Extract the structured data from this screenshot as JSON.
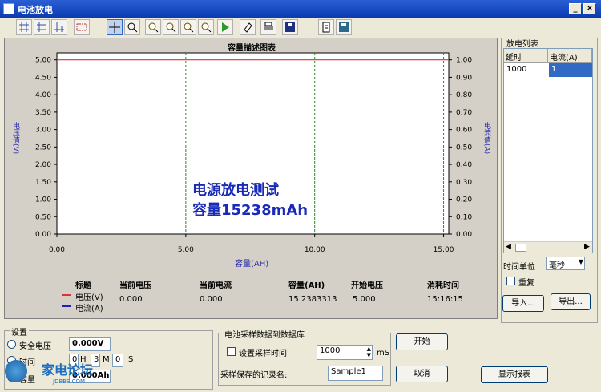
{
  "window": {
    "title": "电池放电",
    "min": "_",
    "close": "×"
  },
  "toolbar": {
    "icons": [
      "cursor-a-icon",
      "cursor-b-icon",
      "cursor-c-icon",
      "select-rect-icon",
      "pan-icon",
      "zoom-auto-icon",
      "zoom-in-icon",
      "zoom-out-icon",
      "zoom-icon",
      "zoom-fit-icon",
      "play-icon",
      "eraser-icon",
      "print-icon",
      "save-icon",
      "page-icon",
      "disk-icon"
    ]
  },
  "chart": {
    "title": "容量描述图表",
    "ylabel": "电压值(V)",
    "y2label": "电流值(A)",
    "xlabel": "容量(AH)",
    "overlay1": "电源放电测试",
    "overlay2": "容量15238mAh"
  },
  "chart_data": {
    "type": "line",
    "title": "容量描述图表",
    "xlabel": "容量(AH)",
    "ylabel": "电压值(V)",
    "y2label": "电流值(A)",
    "xlim": [
      0,
      15.2
    ],
    "ylim": [
      0,
      5.2
    ],
    "y2lim": [
      0,
      1.04
    ],
    "xticks": [
      "0.00",
      "5.00",
      "10.00",
      "15.00"
    ],
    "yticks": [
      "0.00",
      "0.50",
      "1.00",
      "1.50",
      "2.00",
      "2.50",
      "3.00",
      "3.50",
      "4.00",
      "4.50",
      "5.00"
    ],
    "y2ticks": [
      "0.00",
      "0.10",
      "0.20",
      "0.30",
      "0.40",
      "0.50",
      "0.60",
      "0.70",
      "0.80",
      "0.90",
      "1.00"
    ],
    "vlines": [
      5,
      10,
      15
    ],
    "series": [
      {
        "name": "电压(V)",
        "color": "#e03030",
        "x": [
          0,
          15.2
        ],
        "y": [
          5.0,
          5.0
        ]
      },
      {
        "name": "电流(A)",
        "color": "#2020c0",
        "x": [],
        "y": []
      }
    ],
    "legend_position": "bottom"
  },
  "legend": {
    "headers": [
      "标题",
      "当前电压",
      "当前电流",
      "容量(AH)",
      "开始电压",
      "消耗时间"
    ],
    "row1": {
      "name": "电压(V)",
      "v1": "0.000",
      "v2": "0.000",
      "v3": "15.2383313",
      "v4": "5.000",
      "v5": "15:16:15"
    },
    "row2": {
      "name": "电流(A)"
    }
  },
  "discharge": {
    "group": "放电列表",
    "col1": "延时",
    "col2": "电流(A)",
    "cell1": "1000",
    "cell2": "1",
    "unit_label": "时间单位",
    "unit_value": "毫秒",
    "repeat": "重复",
    "import": "导入...",
    "export": "导出..."
  },
  "settings": {
    "group": "设置",
    "safe_voltage": "安全电压",
    "safe_value": "0.000V",
    "time": "时间",
    "h": "0",
    "h_u": "H",
    "m": "3",
    "m_u": "M",
    "s": "0",
    "s_u": "S",
    "capacity": "容量",
    "cap_value": "0.000Ah"
  },
  "sampling": {
    "group": "电池采样数据到数据库",
    "set_time": "设置采样时间",
    "interval": "1000",
    "unit": "mS",
    "record_label": "采样保存的记录名:",
    "record_value": "Sample1"
  },
  "buttons": {
    "start": "开始",
    "cancel": "取消",
    "report": "显示报表"
  },
  "watermark": {
    "text": "家电论坛",
    "sub": "JDBBS.COM"
  }
}
